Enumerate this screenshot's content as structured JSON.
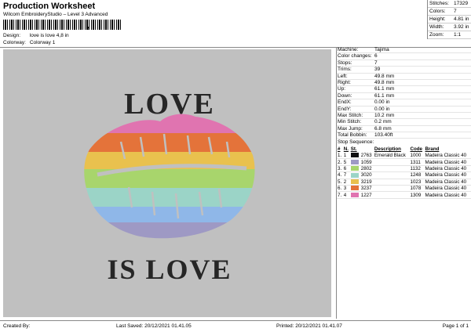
{
  "header": {
    "title": "Production Worksheet",
    "subtitle": "Wilcom EmbroideryStudio – Level 3 Advanced",
    "barcode_mark": ",",
    "design_label": "Design:",
    "design_value": "love is love 4,8 in",
    "colorway_label": "Colorway:",
    "colorway_value": "Colorway 1"
  },
  "stats": {
    "stitches_label": "Stitches:",
    "stitches_value": "17329",
    "colors_label": "Colors:",
    "colors_value": "7",
    "height_label": "Height:",
    "height_value": "4.81 in",
    "width_label": "Width:",
    "width_value": "3.92 in",
    "zoom_label": "Zoom:",
    "zoom_value": "1:1"
  },
  "preview": {
    "top_text": "LOVE",
    "bottom_text": "IS LOVE",
    "background": "#c0c0c0",
    "text_color": "#262626",
    "stripe_colors": [
      "#e074b0",
      "#e4733a",
      "#e9c14e",
      "#a8d56c",
      "#9bd4c7",
      "#8fb7e8",
      "#9e99c4"
    ]
  },
  "machine_info": {
    "rows": [
      {
        "label": "Machine:",
        "value": "Tajima"
      },
      {
        "label": "Color changes:",
        "value": "6"
      },
      {
        "label": "Stops:",
        "value": "7"
      },
      {
        "label": "Trims:",
        "value": "39"
      },
      {
        "label": "Left:",
        "value": "49.8 mm"
      },
      {
        "label": "Right:",
        "value": "49.8 mm"
      },
      {
        "label": "Up:",
        "value": "61.1 mm"
      },
      {
        "label": "Down:",
        "value": "61.1 mm"
      },
      {
        "label": "EndX:",
        "value": "0.00 in"
      },
      {
        "label": "EndY:",
        "value": "0.00 in"
      },
      {
        "label": "Max Stitch:",
        "value": "10.2 mm"
      },
      {
        "label": "Min Stitch:",
        "value": "0.2 mm"
      },
      {
        "label": "Max Jump:",
        "value": "6.8 mm"
      },
      {
        "label": "Total Bobbin:",
        "value": "103.40ft"
      }
    ]
  },
  "stop_sequence": {
    "title": "Stop Sequence:",
    "columns": [
      "#",
      "N.",
      "St.",
      "Description",
      "Code",
      "Brand"
    ],
    "rows": [
      {
        "num": "1.",
        "n": "1",
        "color": "#111111",
        "st": "2763",
        "desc": "Emerald Black",
        "code": "1000",
        "brand": "Madeira Classic 40"
      },
      {
        "num": "2.",
        "n": "5",
        "color": "#9e99c4",
        "st": "1059",
        "desc": "",
        "code": "1311",
        "brand": "Madeira Classic 40"
      },
      {
        "num": "3.",
        "n": "6",
        "color": "#a8d56c",
        "st": "2802",
        "desc": "",
        "code": "1132",
        "brand": "Madeira Classic 40"
      },
      {
        "num": "4.",
        "n": "7",
        "color": "#9bd4c7",
        "st": "3020",
        "desc": "",
        "code": "1248",
        "brand": "Madeira Classic 40"
      },
      {
        "num": "5.",
        "n": "2",
        "color": "#e9c14e",
        "st": "3219",
        "desc": "",
        "code": "1023",
        "brand": "Madeira Classic 40"
      },
      {
        "num": "6.",
        "n": "3",
        "color": "#e4733a",
        "st": "3237",
        "desc": "",
        "code": "1078",
        "brand": "Madeira Classic 40"
      },
      {
        "num": "7.",
        "n": "4",
        "color": "#e074b0",
        "st": "1227",
        "desc": "",
        "code": "1309",
        "brand": "Madeira Classic 40"
      }
    ]
  },
  "footer": {
    "created_by": "Created By:",
    "last_saved": "Last Saved: 20/12/2021 01.41.05",
    "printed": "Printed: 20/12/2021 01.41.07",
    "page": "Page 1 of 1"
  }
}
